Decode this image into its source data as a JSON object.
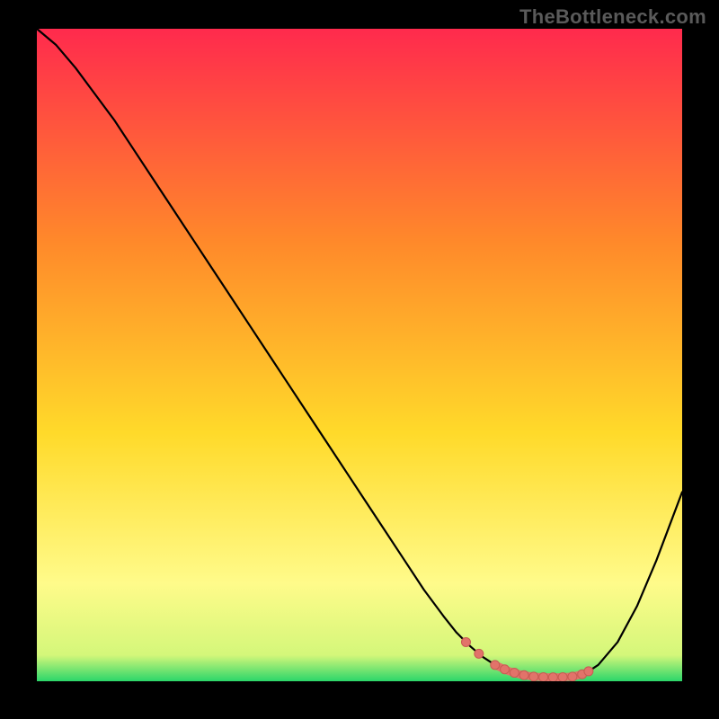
{
  "watermark": "TheBottleneck.com",
  "colors": {
    "bg": "#000000",
    "watermark": "#5a5a5a",
    "curve": "#000000",
    "marker_fill": "#e2736a",
    "marker_stroke": "#c85b53",
    "gradient_top": "#ff2a4d",
    "gradient_mid1": "#ff8a2a",
    "gradient_mid2": "#ffda2a",
    "gradient_mid3": "#fffb8a",
    "gradient_bottom": "#2bd66a"
  },
  "chart_data": {
    "type": "line",
    "title": "",
    "xlabel": "",
    "ylabel": "",
    "xlim": [
      0,
      100
    ],
    "ylim": [
      0,
      100
    ],
    "x": [
      0,
      3,
      6,
      9,
      12,
      15,
      18,
      21,
      24,
      27,
      30,
      33,
      36,
      39,
      42,
      45,
      48,
      51,
      54,
      57,
      60,
      63,
      65,
      67,
      69,
      71,
      73,
      75,
      77,
      79,
      81,
      83,
      85,
      87,
      90,
      93,
      96,
      100
    ],
    "values": [
      100,
      97.5,
      94,
      90,
      86,
      81.5,
      77,
      72.5,
      68,
      63.5,
      59,
      54.5,
      50,
      45.5,
      41,
      36.5,
      32,
      27.5,
      23,
      18.5,
      14,
      10,
      7.5,
      5.5,
      3.8,
      2.5,
      1.6,
      1.0,
      0.7,
      0.6,
      0.6,
      0.7,
      1.2,
      2.5,
      6,
      11.5,
      18.5,
      29
    ],
    "flat_region_x": [
      71.5,
      84
    ],
    "markers_x": [
      66.5,
      68.5,
      71,
      72.5,
      74,
      75.5,
      77,
      78.5,
      80,
      81.5,
      83,
      84.5,
      85.5
    ]
  }
}
